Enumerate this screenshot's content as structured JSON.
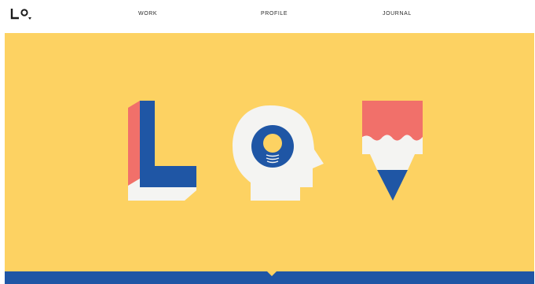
{
  "nav": {
    "work_label": "WORK",
    "profile_label": "PROFILE",
    "journal_label": "JOURNAL"
  },
  "logo": {
    "icon": "lo-monogram-icon"
  },
  "hero": {
    "background": "#fdd262",
    "illustrations": [
      "letter-l-icon",
      "head-lightbulb-icon",
      "pencil-icon"
    ]
  },
  "colors": {
    "yellow": "#fdd262",
    "blue": "#1f56a5",
    "coral": "#f1706a",
    "white": "#f4f4f2"
  }
}
